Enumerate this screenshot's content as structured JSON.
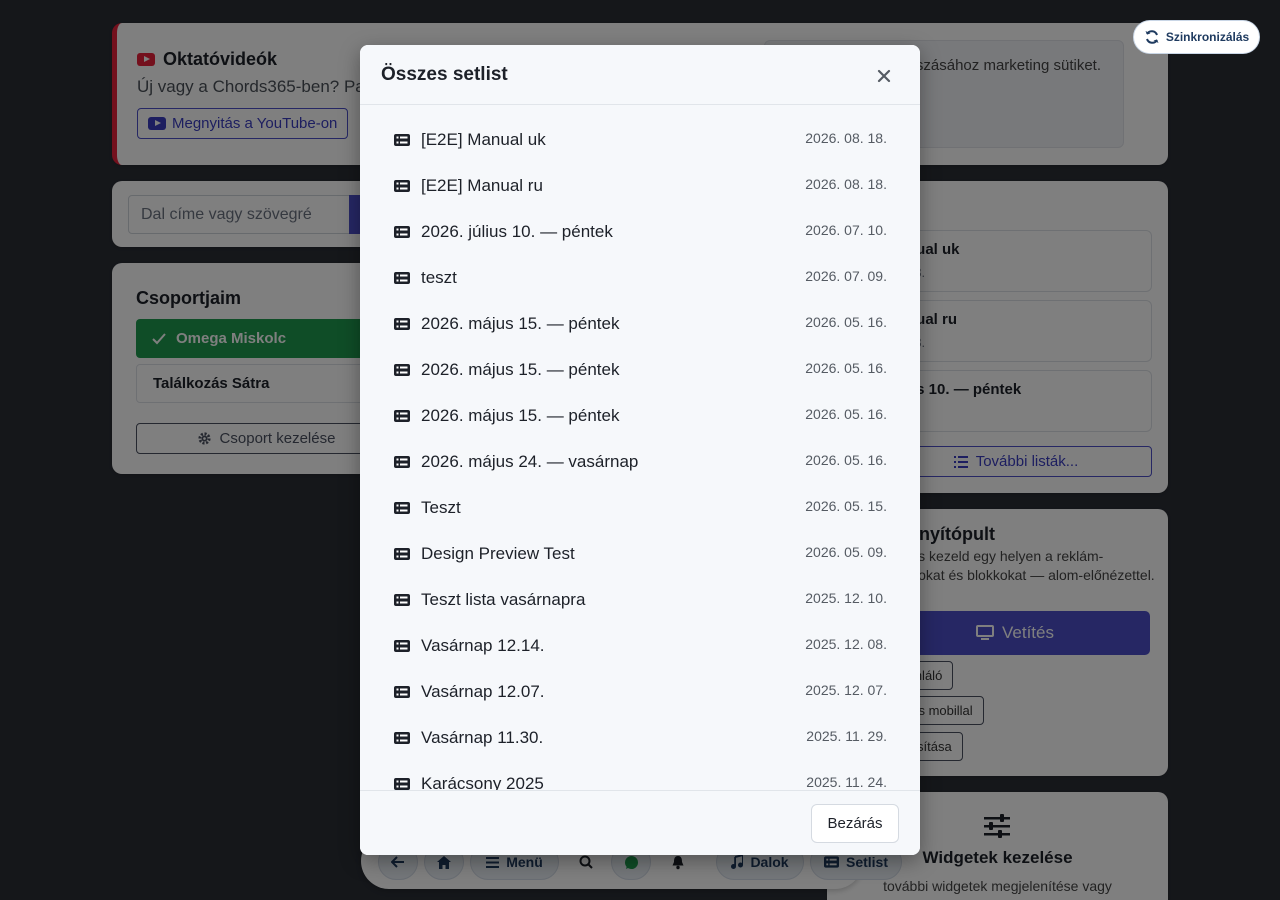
{
  "background": {
    "tutorial": {
      "title": "Oktatóvideók",
      "subtitle": "Új vagy a Chords365-ben? Pa",
      "youtube_button": "Megnyitás a YouTube-on",
      "cookie_notice": "ott lejátszásához marketing sütiket."
    },
    "sync_button": "Szinkronizálás",
    "search": {
      "placeholder": "Dal címe vagy szövegré"
    },
    "groups": {
      "title": "Csoportjaim",
      "active": "Omega Miskolc",
      "item": "Találkozás Sátra",
      "manage": "Csoport kezelése"
    },
    "setlists_preview": {
      "items": [
        {
          "title": "nual uk",
          "date": "18."
        },
        {
          "title": "nual ru",
          "date": "18."
        },
        {
          "title": "us 10. — péntek",
          "date": "0."
        }
      ],
      "more": "További listák..."
    },
    "dashboard": {
      "title": "rányítópult",
      "text": "tből, és kezeld egy helyen a reklám-diasorokat és blokkokat — alom-előnézettel.",
      "vetites": "Vetítés",
      "btn1": "számláló",
      "btn2": "kozás mobillal",
      "btn3": "párosítása"
    },
    "widgets": {
      "title": "Widgetek kezelése",
      "text": "további widgetek megjelenítése vagy"
    },
    "bottom_nav": {
      "menu": "Menü",
      "songs": "Dalok",
      "setlist": "Setlist"
    }
  },
  "modal": {
    "title": "Összes setlist",
    "close_label": "Bezárás",
    "rows": [
      {
        "name": "[E2E] Manual uk",
        "date": "2026. 08. 18."
      },
      {
        "name": "[E2E] Manual ru",
        "date": "2026. 08. 18."
      },
      {
        "name": "2026. július 10. — péntek",
        "date": "2026. 07. 10."
      },
      {
        "name": "teszt",
        "date": "2026. 07. 09."
      },
      {
        "name": "2026. május 15. — péntek",
        "date": "2026. 05. 16."
      },
      {
        "name": "2026. május 15. — péntek",
        "date": "2026. 05. 16."
      },
      {
        "name": "2026. május 15. — péntek",
        "date": "2026. 05. 16."
      },
      {
        "name": "2026. május 24. — vasárnap",
        "date": "2026. 05. 16."
      },
      {
        "name": "Teszt",
        "date": "2026. 05. 15."
      },
      {
        "name": "Design Preview Test",
        "date": "2026. 05. 09."
      },
      {
        "name": "Teszt lista vasárnapra",
        "date": "2025. 12. 10."
      },
      {
        "name": "Vasárnap 12.14.",
        "date": "2025. 12. 08."
      },
      {
        "name": "Vasárnap 12.07.",
        "date": "2025. 12. 07."
      },
      {
        "name": "Vasárnap 11.30.",
        "date": "2025. 11. 29."
      },
      {
        "name": "Karácsony 2025",
        "date": "2025. 11. 24."
      }
    ]
  }
}
